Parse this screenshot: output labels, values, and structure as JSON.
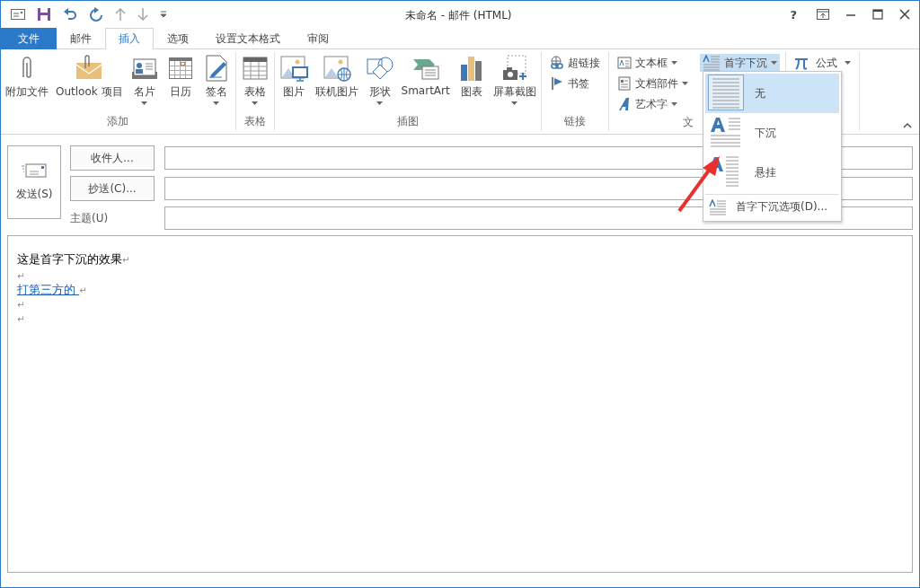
{
  "title_bar": {
    "title": "未命名 - 邮件 (HTML)",
    "help": "?"
  },
  "tabs": [
    {
      "label": "文件",
      "kind": "file",
      "selected": false
    },
    {
      "label": "邮件",
      "kind": "tab",
      "selected": false
    },
    {
      "label": "插入",
      "kind": "tab",
      "selected": true
    },
    {
      "label": "选项",
      "kind": "tab",
      "selected": false
    },
    {
      "label": "设置文本格式",
      "kind": "tab",
      "selected": false
    },
    {
      "label": "审阅",
      "kind": "tab",
      "selected": false
    }
  ],
  "ribbon": {
    "groups": [
      {
        "kind": "large",
        "label": "添加",
        "buttons": [
          {
            "label": "附加文件",
            "dropdown": false
          },
          {
            "label": "Outlook 项目",
            "dropdown": false
          },
          {
            "label": "名片",
            "dropdown": true
          },
          {
            "label": "日历",
            "dropdown": false
          },
          {
            "label": "签名",
            "dropdown": true
          }
        ]
      },
      {
        "kind": "large",
        "label": "表格",
        "buttons": [
          {
            "label": "表格",
            "dropdown": true
          }
        ]
      },
      {
        "kind": "large",
        "label": "插图",
        "buttons": [
          {
            "label": "图片",
            "dropdown": false
          },
          {
            "label": "联机图片",
            "dropdown": false
          },
          {
            "label": "形状",
            "dropdown": true
          },
          {
            "label": "SmartArt",
            "dropdown": false
          },
          {
            "label": "图表",
            "dropdown": false
          },
          {
            "label": "屏幕截图",
            "dropdown": true
          }
        ]
      },
      {
        "kind": "small",
        "label": "链接",
        "buttons": [
          {
            "label": "超链接",
            "dropdown": false
          },
          {
            "label": "书签",
            "dropdown": false
          }
        ]
      },
      {
        "kind": "text",
        "label": "文",
        "buttons": [
          {
            "label": "文本框",
            "dropdown": true
          },
          {
            "label": "文档部件",
            "dropdown": true
          },
          {
            "label": "艺术字",
            "dropdown": true
          }
        ],
        "drop_cap": {
          "label": "首字下沉",
          "expanded": true
        }
      },
      {
        "kind": "symbols",
        "button": {
          "label": "公式"
        }
      }
    ]
  },
  "drop_cap_menu": {
    "items": [
      {
        "label": "无",
        "selected": true
      },
      {
        "label": "下沉",
        "selected": false
      },
      {
        "label": "悬挂",
        "selected": false
      }
    ],
    "footer": "首字下沉选项(D)..."
  },
  "message": {
    "send": "发送(S)",
    "to_button": "收件人...",
    "cc_button": "抄送(C)...",
    "subject_label": "主题(U)",
    "body": [
      {
        "kind": "text",
        "text": "这是首字下沉的效果",
        "mark": "↵"
      },
      {
        "kind": "empty",
        "mark": "↵"
      },
      {
        "kind": "link",
        "text": "打第三方的 ",
        "mark": "↵"
      },
      {
        "kind": "empty",
        "mark": "↵"
      },
      {
        "kind": "empty",
        "mark": "↵"
      }
    ]
  }
}
